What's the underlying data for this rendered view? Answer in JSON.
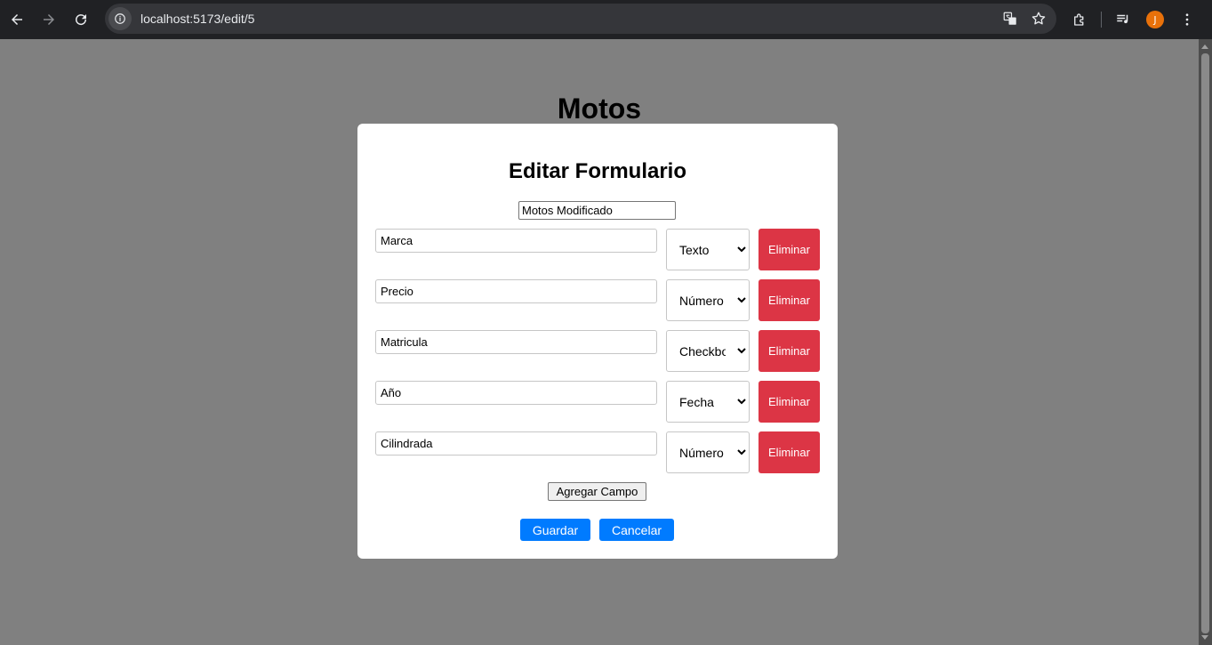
{
  "browser": {
    "url": "localhost:5173/edit/5",
    "avatar_initial": "J"
  },
  "page": {
    "title": "Motos"
  },
  "modal": {
    "title": "Editar Formulario",
    "form_name_value": "Motos Modificado",
    "fields": [
      {
        "name": "Marca",
        "type": "Texto"
      },
      {
        "name": "Precio",
        "type": "Número"
      },
      {
        "name": "Matricula",
        "type": "Checkbox"
      },
      {
        "name": "Año",
        "type": "Fecha"
      },
      {
        "name": "Cilindrada",
        "type": "Número"
      }
    ],
    "delete_label": "Eliminar",
    "add_field_label": "Agregar Campo",
    "save_label": "Guardar",
    "cancel_label": "Cancelar"
  },
  "colors": {
    "delete": "#dc3545",
    "primary": "#007bff",
    "overlay": "#808080"
  }
}
